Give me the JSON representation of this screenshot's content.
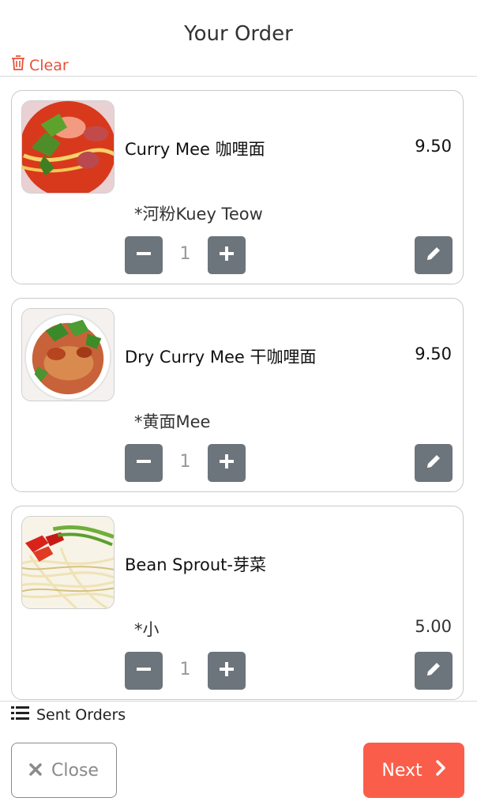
{
  "header": {
    "title": "Your Order",
    "clear_label": "Clear"
  },
  "items": [
    {
      "name": "Curry Mee 咖哩面",
      "price": "9.50",
      "option": "*河粉Kuey Teow",
      "quantity": "1",
      "image_icon": "curry-mee-photo"
    },
    {
      "name": "Dry Curry Mee 干咖哩面",
      "price": "9.50",
      "option": "*黄面Mee",
      "quantity": "1",
      "image_icon": "dry-curry-mee-photo"
    },
    {
      "name": "Bean Sprout-芽菜",
      "option": "*小",
      "option_price": "5.00",
      "quantity": "1",
      "image_icon": "bean-sprout-photo"
    }
  ],
  "footer": {
    "sent_orders_label": "Sent Orders",
    "close_label": "Close",
    "next_label": "Next"
  },
  "colors": {
    "accent": "#fa5e4a",
    "clear": "#e8503a",
    "button_gray": "#6c747c"
  }
}
